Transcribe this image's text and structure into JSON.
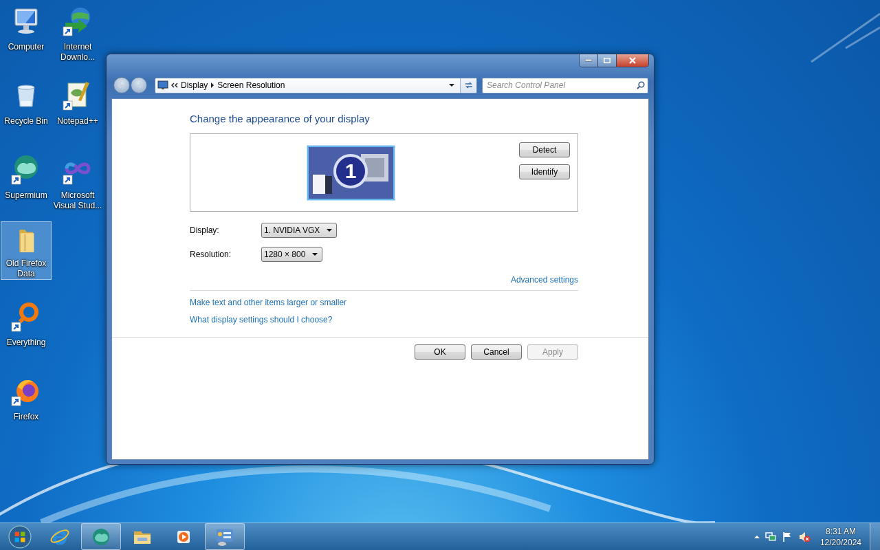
{
  "desktop": {
    "columns": [
      [
        {
          "label": "Computer",
          "kind": "computer",
          "shortcut": false,
          "selected": false
        },
        {
          "label": "Recycle Bin",
          "kind": "bin",
          "shortcut": false,
          "selected": false
        },
        {
          "label": "Supermium",
          "kind": "orb",
          "shortcut": true,
          "selected": false
        },
        {
          "label": "Old Firefox Data",
          "kind": "folder",
          "shortcut": false,
          "selected": true
        },
        {
          "label": "Everything",
          "kind": "ring",
          "shortcut": true,
          "selected": false
        },
        {
          "label": "Firefox",
          "kind": "firefox",
          "shortcut": true,
          "selected": false
        }
      ],
      [
        {
          "label": "Internet Downlo...",
          "kind": "globe",
          "shortcut": true,
          "selected": false
        },
        {
          "label": "Notepad++",
          "kind": "notepad",
          "shortcut": true,
          "selected": false
        },
        {
          "label": "Microsoft Visual Stud...",
          "kind": "infinity",
          "shortcut": true,
          "selected": false
        }
      ]
    ]
  },
  "window": {
    "breadcrumb": [
      "Display",
      "Screen Resolution"
    ],
    "search": {
      "placeholder": "Search Control Panel"
    },
    "heading": "Change the appearance of your display",
    "monitor": {
      "number": "1",
      "selected": true
    },
    "preview_buttons": [
      "Detect",
      "Identify"
    ],
    "fields": [
      {
        "label": "Display:",
        "value": "1. NVIDIA VGX"
      },
      {
        "label": "Resolution:",
        "value": "1280 × 800"
      }
    ],
    "advanced_link": "Advanced settings",
    "links": [
      "Make text and other items larger or smaller",
      "What display settings should I choose?"
    ],
    "buttons": [
      {
        "label": "OK",
        "disabled": false
      },
      {
        "label": "Cancel",
        "disabled": false
      },
      {
        "label": "Apply",
        "disabled": true
      }
    ]
  },
  "taskbar": {
    "items": [
      {
        "kind": "ie",
        "open": false
      },
      {
        "kind": "orb",
        "open": true
      },
      {
        "kind": "folder",
        "open": false
      },
      {
        "kind": "media",
        "open": false
      },
      {
        "kind": "control_panel",
        "open": true
      }
    ],
    "tray": {
      "muted": true,
      "time": "8:31 AM",
      "date": "12/20/2024"
    }
  }
}
